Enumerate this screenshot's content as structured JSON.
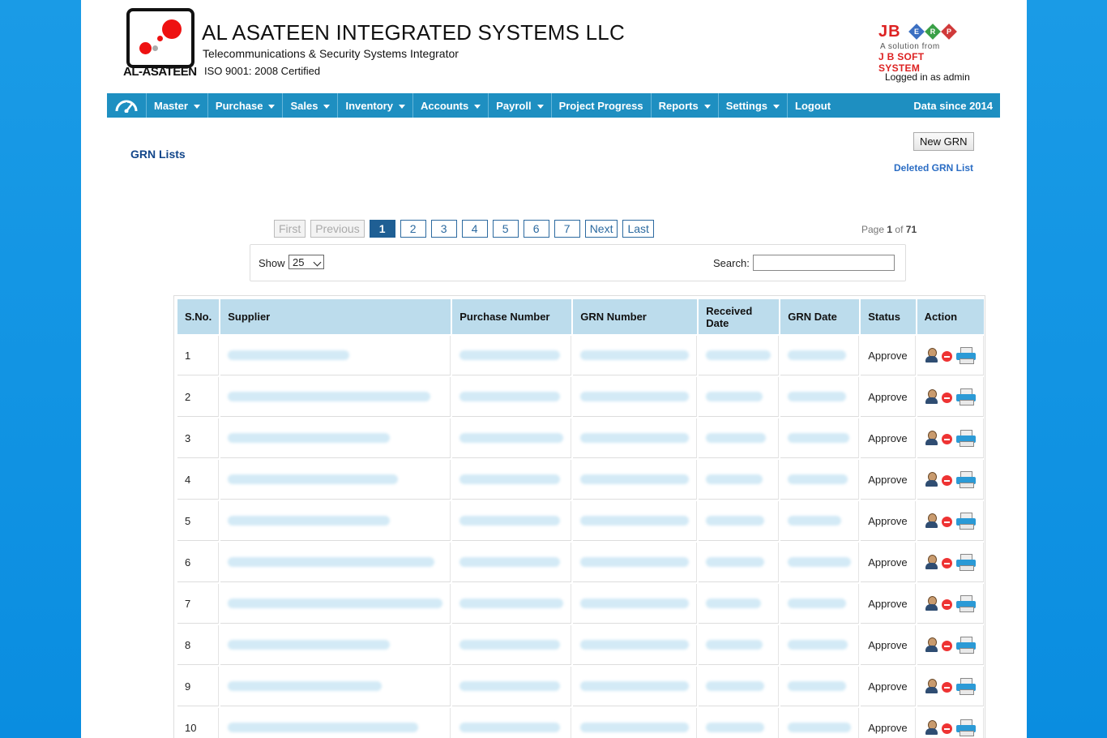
{
  "header": {
    "logo_text": "AL-ASATEEN",
    "company_name": "AL ASATEEN INTEGRATED SYSTEMS LLC",
    "tagline": "Telecommunications & Security Systems Integrator",
    "iso": "ISO 9001: 2008 Certified",
    "jb_brand": "JB",
    "jb_diamonds": [
      "E",
      "R",
      "P"
    ],
    "jb_solution": "A solution from",
    "jb_system": "J B SOFT SYSTEM",
    "logged_in": "Logged in as admin"
  },
  "nav": {
    "home_icon": "dashboard-icon",
    "items": [
      {
        "label": "Master",
        "dropdown": true
      },
      {
        "label": "Purchase",
        "dropdown": true
      },
      {
        "label": "Sales",
        "dropdown": true
      },
      {
        "label": "Inventory",
        "dropdown": true
      },
      {
        "label": "Accounts",
        "dropdown": true
      },
      {
        "label": "Payroll",
        "dropdown": true
      },
      {
        "label": "Project Progress",
        "dropdown": false
      },
      {
        "label": "Reports",
        "dropdown": true
      },
      {
        "label": "Settings",
        "dropdown": true
      },
      {
        "label": "Logout",
        "dropdown": false
      }
    ],
    "data_since": "Data since 2014"
  },
  "main": {
    "title": "GRN Lists",
    "new_button": "New GRN",
    "deleted_link": "Deleted GRN List"
  },
  "pager": {
    "first": "First",
    "previous": "Previous",
    "pages": [
      "1",
      "2",
      "3",
      "4",
      "5",
      "6",
      "7"
    ],
    "active_page": "1",
    "next": "Next",
    "last": "Last",
    "info_prefix": "Page",
    "current": "1",
    "info_of": "of",
    "total": "71"
  },
  "filter": {
    "show_label": "Show",
    "show_value": "25",
    "search_label": "Search:",
    "search_value": ""
  },
  "table": {
    "columns": [
      "S.No.",
      "Supplier",
      "Purchase Number",
      "GRN Number",
      "Received Date",
      "GRN Date",
      "Status",
      "Action"
    ],
    "rows": [
      {
        "sno": "1",
        "status": "Approve"
      },
      {
        "sno": "2",
        "status": "Approve"
      },
      {
        "sno": "3",
        "status": "Approve"
      },
      {
        "sno": "4",
        "status": "Approve"
      },
      {
        "sno": "5",
        "status": "Approve"
      },
      {
        "sno": "6",
        "status": "Approve"
      },
      {
        "sno": "7",
        "status": "Approve"
      },
      {
        "sno": "8",
        "status": "Approve"
      },
      {
        "sno": "9",
        "status": "Approve"
      },
      {
        "sno": "10",
        "status": "Approve"
      }
    ],
    "action_icons": [
      "user-icon",
      "delete-icon",
      "print-icon"
    ]
  }
}
